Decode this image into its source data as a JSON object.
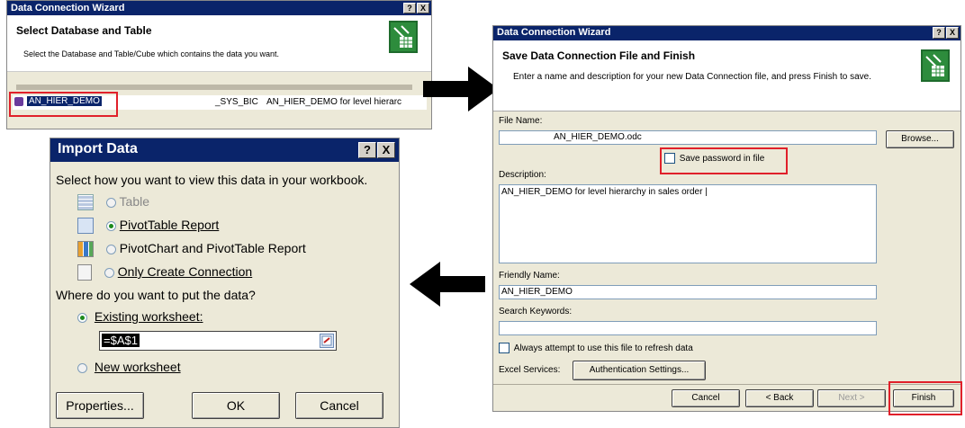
{
  "select_db": {
    "title": "Data Connection Wizard",
    "help_btn": "?",
    "close_btn": "X",
    "header": "Select Database and Table",
    "subheader": "Select the Database and Table/Cube which contains the data you want.",
    "rows": [
      {
        "name": "AN_HIER_DEMO",
        "schema": "_SYS_BIC",
        "description": "AN_HIER_DEMO for level hierarc"
      }
    ]
  },
  "import_data": {
    "title": "Import Data",
    "help_btn": "?",
    "close_btn": "X",
    "question1": "Select how you want to view this data in your workbook.",
    "options": [
      {
        "label": "Table",
        "selected": false,
        "enabled": false
      },
      {
        "label": "PivotTable Report",
        "selected": true,
        "enabled": true
      },
      {
        "label": "PivotChart and PivotTable Report",
        "selected": false,
        "enabled": true
      },
      {
        "label": "Only Create Connection",
        "selected": false,
        "enabled": true
      }
    ],
    "question2": "Where do you want to put the data?",
    "existing_label": "Existing worksheet:",
    "existing_value": "=$A$1",
    "new_label": "New worksheet",
    "properties_btn": "Properties...",
    "ok_btn": "OK",
    "cancel_btn": "Cancel"
  },
  "save_conn": {
    "title": "Data Connection Wizard",
    "help_btn": "?",
    "close_btn": "X",
    "header": "Save Data Connection File and Finish",
    "subheader": "Enter a name and description for your new Data Connection file, and press Finish to save.",
    "file_name_label": "File Name:",
    "file_name_value": "AN_HIER_DEMO.odc",
    "browse_btn": "Browse...",
    "save_password_label": "Save password in file",
    "description_label": "Description:",
    "description_value": "AN_HIER_DEMO for level hierarchy in sales order |",
    "friendly_label": "Friendly Name:",
    "friendly_value": "AN_HIER_DEMO",
    "keywords_label": "Search Keywords:",
    "keywords_value": "",
    "always_label": "Always attempt to use this file to refresh data",
    "excel_services_label": "Excel Services:",
    "auth_btn": "Authentication Settings...",
    "cancel_btn": "Cancel",
    "back_btn": "< Back",
    "next_btn": "Next >",
    "finish_btn": "Finish"
  },
  "colors": {
    "title_bg": "#0a246a",
    "highlight_red": "#e0202a",
    "dialog_bg": "#ece9d8"
  }
}
